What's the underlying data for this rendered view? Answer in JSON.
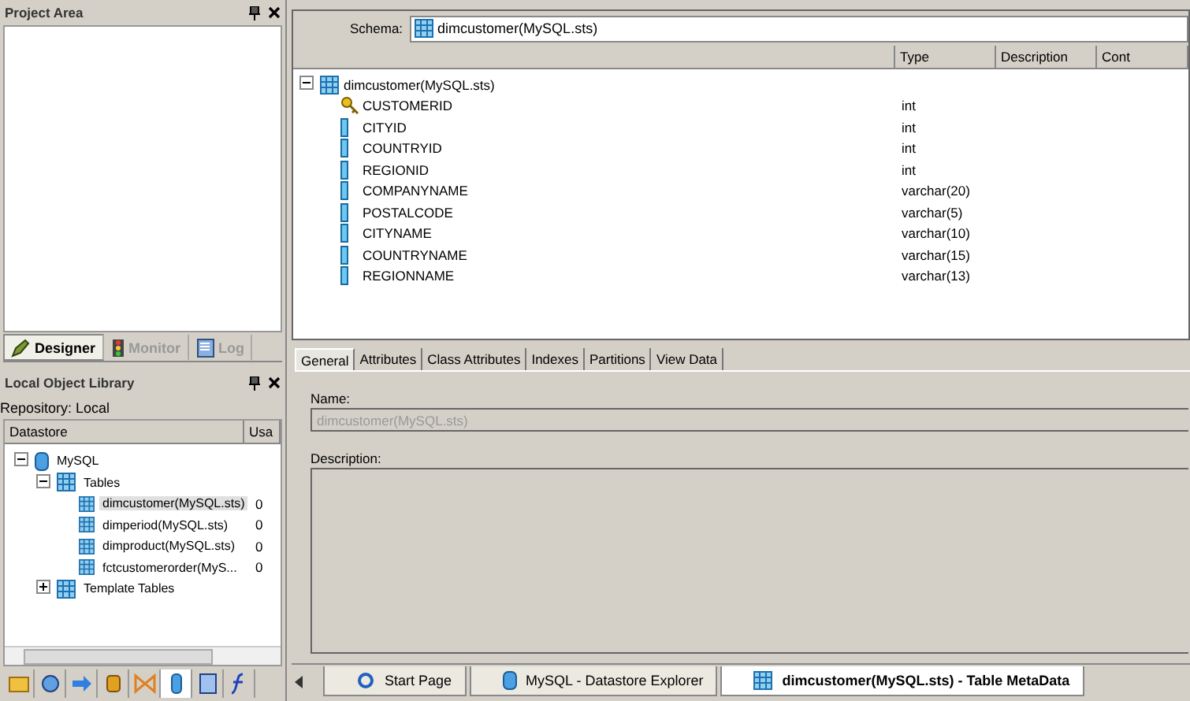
{
  "project_area": {
    "title": "Project Area"
  },
  "designer_tabs": [
    {
      "label": "Designer",
      "kind": "designer",
      "selected": true
    },
    {
      "label": "Monitor",
      "kind": "monitor",
      "selected": false
    },
    {
      "label": "Log",
      "kind": "log",
      "selected": false
    }
  ],
  "object_library": {
    "title": "Local Object Library",
    "repository": "Repository: Local",
    "columns": [
      "Datastore",
      "Usa"
    ],
    "tree": [
      {
        "label": "MySQL",
        "kind": "datastore",
        "expanded": true,
        "children": [
          {
            "label": "Tables",
            "kind": "folder",
            "expanded": true,
            "children": [
              {
                "label": "dimcustomer(MySQL.sts)",
                "kind": "table",
                "usage": "0",
                "selected": true
              },
              {
                "label": "dimperiod(MySQL.sts)",
                "kind": "table",
                "usage": "0",
                "selected": false
              },
              {
                "label": "dimproduct(MySQL.sts)",
                "kind": "table",
                "usage": "0",
                "selected": false
              },
              {
                "label": "fctcustomerorder(MyS...",
                "kind": "table",
                "usage": "0",
                "selected": false
              }
            ]
          },
          {
            "label": "Template Tables",
            "kind": "folder",
            "expanded": false
          }
        ]
      }
    ]
  },
  "library_tabs": [
    {
      "kind": "folder",
      "selected": false
    },
    {
      "kind": "job",
      "selected": false
    },
    {
      "kind": "flow",
      "selected": false
    },
    {
      "kind": "transform",
      "selected": false
    },
    {
      "kind": "join",
      "selected": false
    },
    {
      "kind": "datastore",
      "selected": true
    },
    {
      "kind": "format",
      "selected": false
    },
    {
      "kind": "function",
      "selected": false
    }
  ],
  "schema": {
    "label": "Schema:",
    "value": "dimcustomer(MySQL.sts)"
  },
  "columns": [
    "Type",
    "Description",
    "Cont"
  ],
  "table_tree": {
    "label": "dimcustomer(MySQL.sts)",
    "expanded": true,
    "fields": [
      {
        "name": "CUSTOMERID",
        "type": "int",
        "primary_key": true
      },
      {
        "name": "CITYID",
        "type": "int",
        "primary_key": false
      },
      {
        "name": "COUNTRYID",
        "type": "int",
        "primary_key": false
      },
      {
        "name": "REGIONID",
        "type": "int",
        "primary_key": false
      },
      {
        "name": "COMPANYNAME",
        "type": "varchar(20)",
        "primary_key": false
      },
      {
        "name": "POSTALCODE",
        "type": "varchar(5)",
        "primary_key": false
      },
      {
        "name": "CITYNAME",
        "type": "varchar(10)",
        "primary_key": false
      },
      {
        "name": "COUNTRYNAME",
        "type": "varchar(15)",
        "primary_key": false
      },
      {
        "name": "REGIONNAME",
        "type": "varchar(13)",
        "primary_key": false
      }
    ]
  },
  "detail_tabs": [
    {
      "label": "General",
      "selected": true
    },
    {
      "label": "Attributes",
      "selected": false
    },
    {
      "label": "Class Attributes",
      "selected": false
    },
    {
      "label": "Indexes",
      "selected": false
    },
    {
      "label": "Partitions",
      "selected": false
    },
    {
      "label": "View Data",
      "selected": false
    }
  ],
  "name_field": {
    "label": "Name:",
    "value": "dimcustomer(MySQL.sts)",
    "disabled": true
  },
  "description_field": {
    "label": "Description:"
  },
  "document_tabs": [
    {
      "label": "Start Page",
      "kind": "start",
      "selected": false
    },
    {
      "label": "MySQL - Datastore Explorer",
      "kind": "datastore",
      "selected": false
    },
    {
      "label": "dimcustomer(MySQL.sts) - Table MetaData",
      "kind": "table",
      "selected": true
    }
  ]
}
